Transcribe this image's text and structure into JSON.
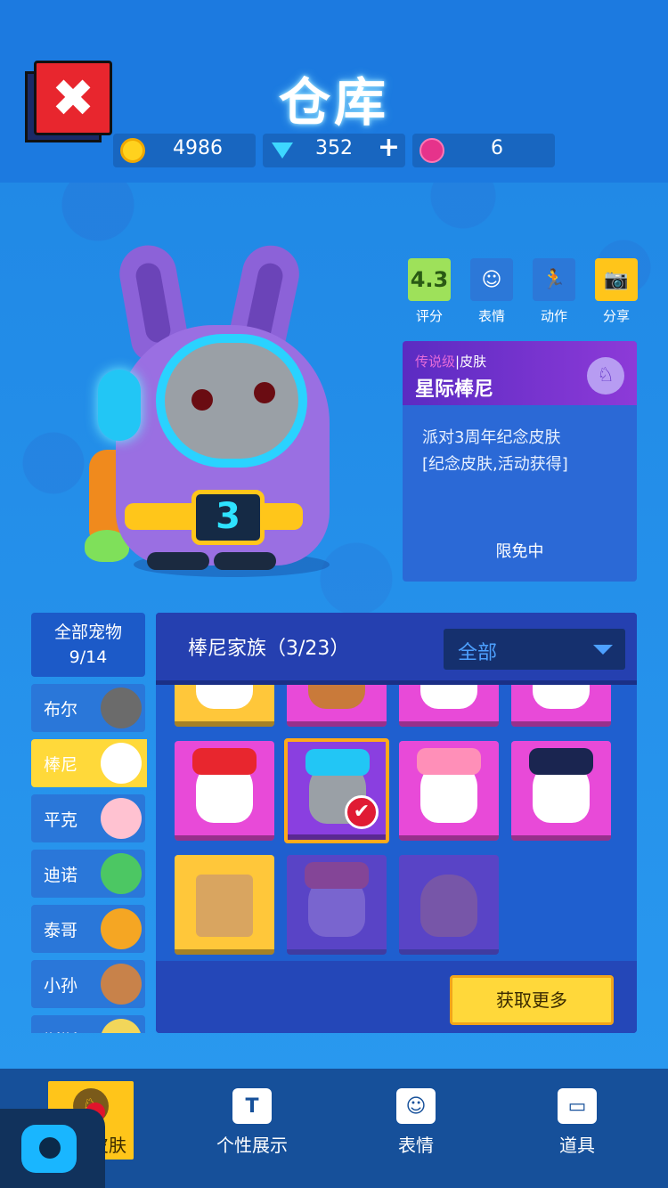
{
  "header": {
    "title": "仓库",
    "close_label": "✖",
    "currencies": [
      {
        "name": "coin",
        "value": "4986"
      },
      {
        "name": "gem",
        "value": "352",
        "add_label": "+"
      },
      {
        "name": "lotus",
        "value": "6"
      }
    ]
  },
  "actions": [
    {
      "name": "rating",
      "icon_text": "4.3",
      "label": "评分"
    },
    {
      "name": "emote",
      "icon_text": "☺",
      "label": "表情"
    },
    {
      "name": "motion",
      "icon_text": "🏃",
      "label": "动作"
    },
    {
      "name": "share",
      "icon_text": "📷",
      "label": "分享"
    }
  ],
  "skin_card": {
    "tier": "传说级",
    "sep": "|",
    "type": "皮肤",
    "name": "星际棒尼",
    "desc_line1": "派对3周年纪念皮肤",
    "desc_line2": "[纪念皮肤,活动获得]",
    "status": "限免中",
    "badge_number": "3"
  },
  "families": {
    "all_label": "全部宠物",
    "all_count": "9/14",
    "items": [
      {
        "name": "布尔",
        "color": "#6b6b6b"
      },
      {
        "name": "棒尼",
        "color": "#ffffff",
        "selected": true
      },
      {
        "name": "平克",
        "color": "#ffc2d1"
      },
      {
        "name": "迪诺",
        "color": "#4cc763"
      },
      {
        "name": "泰哥",
        "color": "#f5a623"
      },
      {
        "name": "小孙",
        "color": "#c8824a"
      },
      {
        "name": "斯斯",
        "color": "#f2d65a"
      }
    ]
  },
  "panel": {
    "title": "棒尼家族（3/23）",
    "filter_value": "全部",
    "get_more_label": "获取更多",
    "check_mark": "✔"
  },
  "nav": {
    "pet_skin": "宠物皮肤",
    "showcase": "个性展示",
    "emote": "表情",
    "items": "道具"
  }
}
